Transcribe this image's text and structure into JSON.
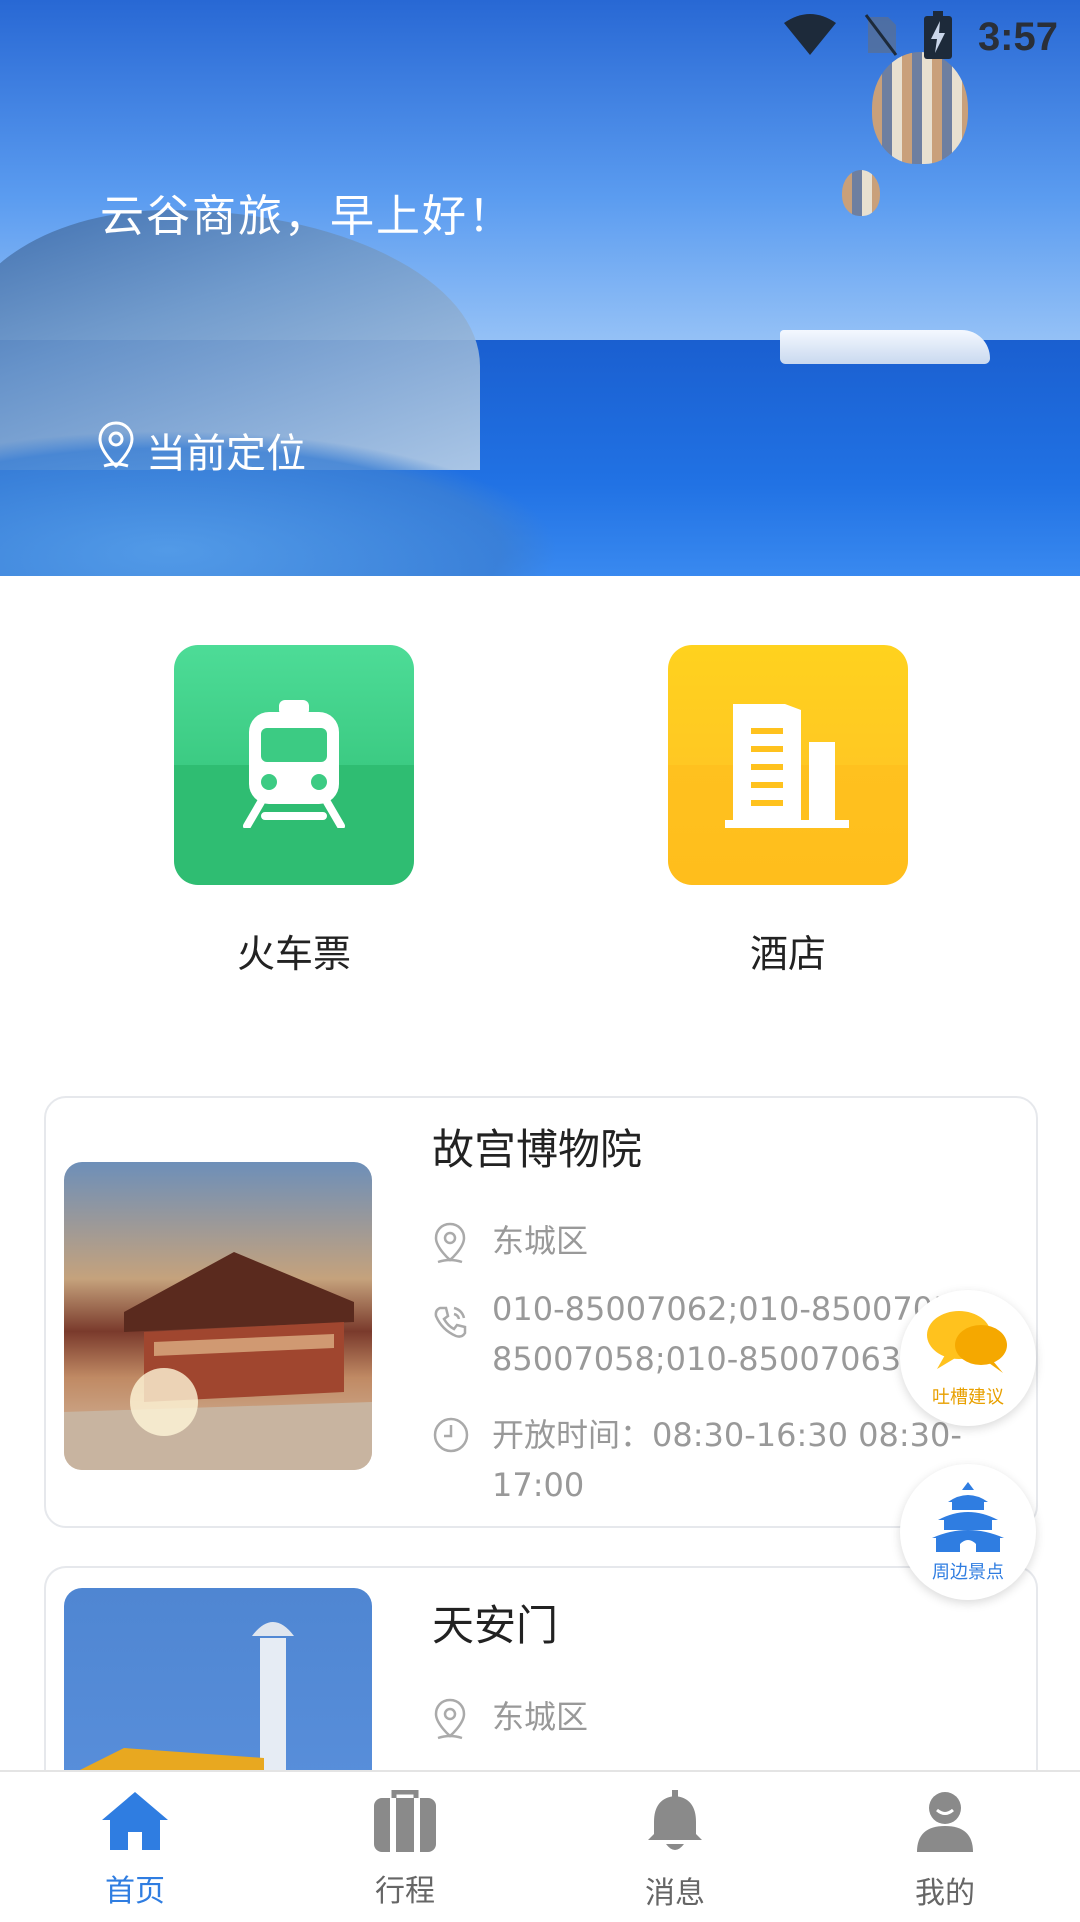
{
  "status_bar": {
    "time": "3:57"
  },
  "banner": {
    "greeting": "云谷商旅，早上好！",
    "location_label": "当前定位"
  },
  "services": [
    {
      "label": "火车票",
      "icon": "train-icon",
      "color": "#3ECF86"
    },
    {
      "label": "酒店",
      "icon": "building-icon",
      "color": "#FFC21E"
    }
  ],
  "attractions": [
    {
      "name": "故宫博物院",
      "district": "东城区",
      "phone_line1": "010-85007062;010-85007057",
      "phone_line2": "85007058;010-85007063",
      "hours_line1": "开放时间：08:30-16:30 08:30-",
      "hours_line2": "17:00"
    },
    {
      "name": "天安门",
      "district": "东城区"
    }
  ],
  "floating": {
    "feedback_label": "吐槽建议",
    "nearby_label": "周边景点"
  },
  "tabbar": {
    "items": [
      {
        "label": "首页",
        "icon": "home-icon"
      },
      {
        "label": "行程",
        "icon": "suitcase-icon"
      },
      {
        "label": "消息",
        "icon": "bell-icon"
      },
      {
        "label": "我的",
        "icon": "person-icon"
      }
    ],
    "active_color": "#2F7DE1",
    "inactive_color": "#888888"
  }
}
